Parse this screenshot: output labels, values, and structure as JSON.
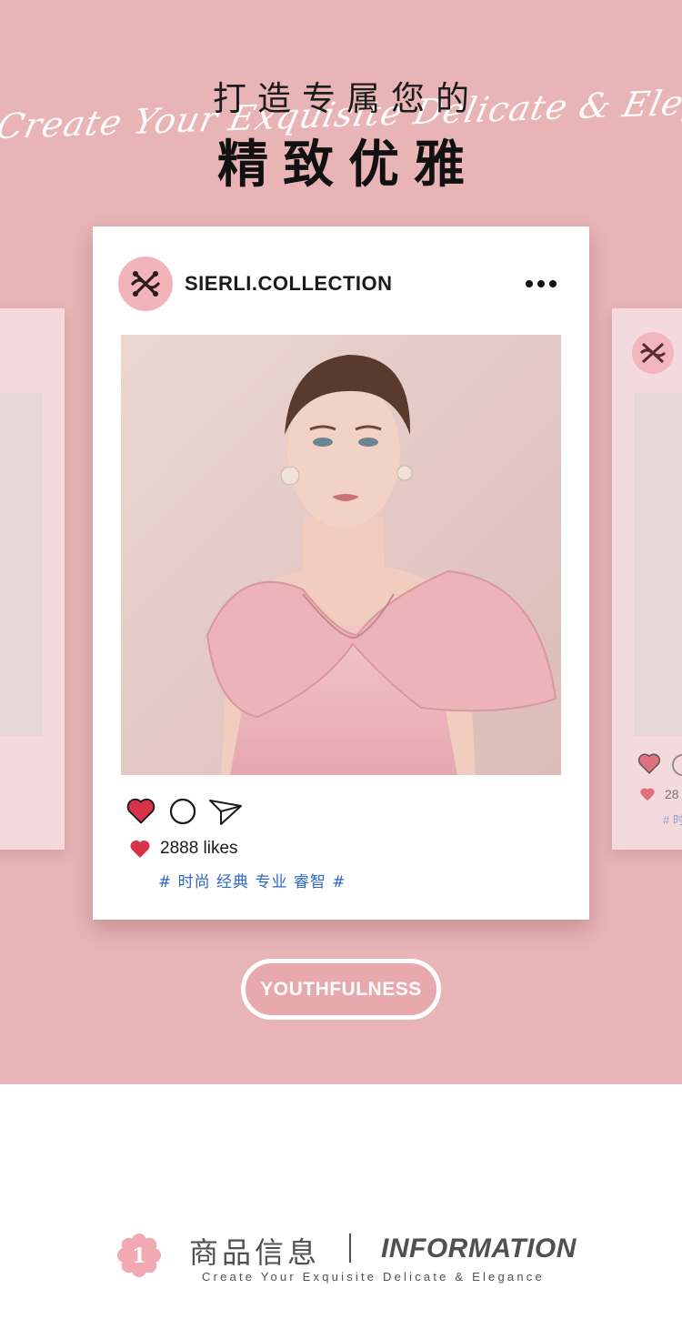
{
  "hero": {
    "script_text": "Create Your Exquisite Delicate & Elegance",
    "title_line1": "打造专属您的",
    "title_line2": "精致优雅",
    "background_color": "#e8b4b6"
  },
  "post": {
    "account_name": "SIERLI.COLLECTION",
    "more_icon": "more-dots-icon",
    "photo_alt": "model photo",
    "actions": {
      "like_icon": "heart-icon",
      "comment_icon": "comment-icon",
      "share_icon": "send-icon"
    },
    "likes_text": "2888 likes",
    "hashtags": "# 时尚 经典 专业 睿智 #"
  },
  "side_card_right": {
    "likes_text": "28",
    "tag_text": "# 时"
  },
  "button": {
    "label": "YOUTHFULNESS"
  },
  "section": {
    "number": "1",
    "title_cn": "商品信息",
    "title_en": "INFORMATION",
    "subtitle": "Create Your Exquisite Delicate & Elegance",
    "accent_color": "#f2a9b2"
  }
}
